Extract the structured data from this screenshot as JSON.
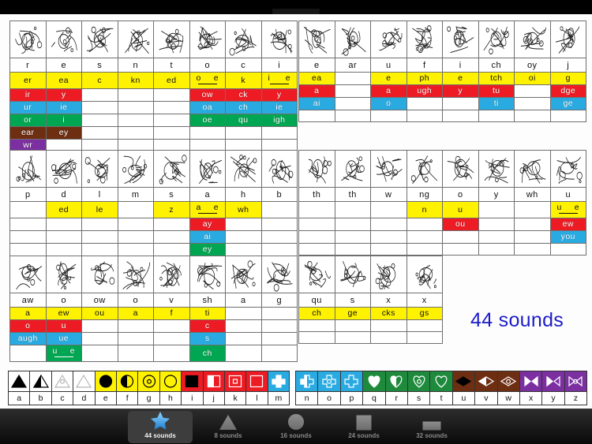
{
  "app": {
    "title": "44 sounds",
    "caption": "44 sounds",
    "caption_color": "#1B1BC9"
  },
  "colors": {
    "yellow": "#FFF200",
    "red": "#ED1C24",
    "blue": "#29ABE2",
    "green": "#00A651",
    "brown": "#6D2E12",
    "purple": "#7B2FA0",
    "accent": "#1B1BC9"
  },
  "tables": [
    {
      "id": "table-1",
      "headers": [
        "r",
        "e",
        "s",
        "n",
        "t",
        "o",
        "c",
        "i"
      ],
      "rows": [
        {
          "color": "yellow",
          "cells": [
            "er",
            "ea",
            "c",
            "kn",
            "ed",
            "o_e",
            "k",
            "i_e"
          ]
        },
        {
          "color": "red",
          "cells": [
            "ir",
            "y",
            "",
            "",
            "",
            "ow",
            "ck",
            "y"
          ]
        },
        {
          "color": "blue",
          "cells": [
            "ur",
            "ie",
            "",
            "",
            "",
            "oa",
            "ch",
            "ie"
          ]
        },
        {
          "color": "green",
          "cells": [
            "or",
            "i",
            "",
            "",
            "",
            "oe",
            "qu",
            "igh"
          ]
        },
        {
          "color": "brown",
          "cells": [
            "ear",
            "ey",
            "",
            "",
            "",
            "",
            "",
            ""
          ]
        },
        {
          "color": "purple",
          "cells": [
            "wr",
            "",
            "",
            "",
            "",
            "",
            "",
            ""
          ]
        }
      ]
    },
    {
      "id": "table-2",
      "headers": [
        "e",
        "ar",
        "u",
        "f",
        "i",
        "ch",
        "oy",
        "j"
      ],
      "rows": [
        {
          "color": "yellow",
          "cells": [
            "ea",
            "",
            "e",
            "ph",
            "e",
            "tch",
            "oi",
            "g"
          ]
        },
        {
          "color": "red",
          "cells": [
            "a",
            "",
            "a",
            "ugh",
            "y",
            "tu",
            "",
            "dge"
          ]
        },
        {
          "color": "blue",
          "cells": [
            "ai",
            "",
            "o",
            "",
            "",
            "ti",
            "",
            "ge"
          ]
        },
        {
          "color": "blank",
          "cells": [
            "",
            "",
            "",
            "",
            "",
            "",
            "",
            ""
          ]
        }
      ]
    },
    {
      "id": "table-3",
      "headers": [
        "p",
        "d",
        "l",
        "m",
        "s",
        "a",
        "h",
        "b"
      ],
      "rows": [
        {
          "color": "yellow",
          "cells": [
            "",
            "ed",
            "le",
            "",
            "z",
            "a_e",
            "wh",
            ""
          ]
        },
        {
          "color": "red",
          "cells": [
            "",
            "",
            "",
            "",
            "",
            "ay",
            "",
            ""
          ]
        },
        {
          "color": "blue",
          "cells": [
            "",
            "",
            "",
            "",
            "",
            "ai",
            "",
            ""
          ]
        },
        {
          "color": "green",
          "cells": [
            "",
            "",
            "",
            "",
            "",
            "ey",
            "",
            ""
          ]
        }
      ]
    },
    {
      "id": "table-4",
      "headers": [
        "th",
        "th",
        "w",
        "ng",
        "o",
        "y",
        "wh",
        "u"
      ],
      "rows": [
        {
          "color": "yellow",
          "cells": [
            "",
            "",
            "",
            "n",
            "u",
            "",
            "",
            "u_e"
          ]
        },
        {
          "color": "red",
          "cells": [
            "",
            "",
            "",
            "",
            "ou",
            "",
            "",
            "ew"
          ]
        },
        {
          "color": "blue",
          "cells": [
            "",
            "",
            "",
            "",
            "",
            "",
            "",
            "you"
          ]
        },
        {
          "color": "blank",
          "cells": [
            "",
            "",
            "",
            "",
            "",
            "",
            "",
            ""
          ]
        }
      ]
    },
    {
      "id": "table-5",
      "headers": [
        "aw",
        "o",
        "ow",
        "o",
        "v",
        "sh",
        "a",
        "g"
      ],
      "rows": [
        {
          "color": "yellow",
          "cells": [
            "a",
            "ew",
            "ou",
            "a",
            "f",
            "ti",
            "",
            ""
          ]
        },
        {
          "color": "red",
          "cells": [
            "o",
            "u",
            "",
            "",
            "",
            "c",
            "",
            ""
          ]
        },
        {
          "color": "blue",
          "cells": [
            "augh",
            "ue",
            "",
            "",
            "",
            "s",
            "",
            ""
          ]
        },
        {
          "color": "green",
          "cells": [
            "",
            "u_e",
            "",
            "",
            "",
            "ch",
            "",
            ""
          ]
        }
      ]
    },
    {
      "id": "table-6",
      "headers": [
        "qu",
        "s",
        "x",
        "x"
      ],
      "rows": [
        {
          "color": "yellow",
          "cells": [
            "ch",
            "ge",
            "cks",
            "gs"
          ]
        },
        {
          "color": "blank",
          "cells": [
            "",
            "",
            "",
            ""
          ]
        },
        {
          "color": "blank",
          "cells": [
            "",
            "",
            "",
            ""
          ]
        }
      ]
    }
  ],
  "legend": {
    "left": {
      "letters": [
        "a",
        "b",
        "c",
        "d",
        "e",
        "f",
        "g",
        "h",
        "i",
        "j",
        "k",
        "l",
        "m"
      ],
      "symbols": [
        {
          "icon": "triangle-filled-icon",
          "shape": "triangle",
          "fill": "full",
          "bg": "#ffffff",
          "ink": "#000000"
        },
        {
          "icon": "triangle-half-icon",
          "shape": "triangle",
          "fill": "half",
          "bg": "#ffffff",
          "ink": "#000000"
        },
        {
          "icon": "triangle-dot-icon",
          "shape": "triangle",
          "fill": "dot",
          "bg": "#ffffff",
          "ink": "#b5b5b5"
        },
        {
          "icon": "triangle-outline-icon",
          "shape": "triangle",
          "fill": "outline",
          "bg": "#ffffff",
          "ink": "#b5b5b5"
        },
        {
          "icon": "circle-filled-icon",
          "shape": "circle",
          "fill": "full",
          "bg": "#FFF200",
          "ink": "#000000"
        },
        {
          "icon": "circle-half-icon",
          "shape": "circle",
          "fill": "half",
          "bg": "#FFF200",
          "ink": "#000000"
        },
        {
          "icon": "circle-dot-icon",
          "shape": "circle",
          "fill": "dot",
          "bg": "#FFF200",
          "ink": "#000000"
        },
        {
          "icon": "circle-outline-icon",
          "shape": "circle",
          "fill": "outline",
          "bg": "#FFF200",
          "ink": "#000000"
        },
        {
          "icon": "square-filled-icon",
          "shape": "square",
          "fill": "full",
          "bg": "#ED1C24",
          "ink": "#000000"
        },
        {
          "icon": "square-half-icon",
          "shape": "square",
          "fill": "half",
          "bg": "#ED1C24",
          "ink": "#ffffff"
        },
        {
          "icon": "square-dot-icon",
          "shape": "square",
          "fill": "dot",
          "bg": "#ED1C24",
          "ink": "#ffffff"
        },
        {
          "icon": "square-outline-icon",
          "shape": "square",
          "fill": "outline",
          "bg": "#ED1C24",
          "ink": "#ffffff"
        },
        {
          "icon": "cross-filled-icon",
          "shape": "cross",
          "fill": "full",
          "bg": "#29ABE2",
          "ink": "#ffffff"
        }
      ]
    },
    "right": {
      "letters": [
        "n",
        "o",
        "p",
        "q",
        "r",
        "s",
        "t",
        "u",
        "v",
        "w",
        "x",
        "y",
        "z"
      ],
      "symbols": [
        {
          "icon": "cross-half-icon",
          "shape": "cross",
          "fill": "half",
          "bg": "#29ABE2",
          "ink": "#ffffff"
        },
        {
          "icon": "cross-dot-icon",
          "shape": "cross",
          "fill": "dot",
          "bg": "#29ABE2",
          "ink": "#ffffff"
        },
        {
          "icon": "cross-outline-icon",
          "shape": "cross",
          "fill": "outline",
          "bg": "#29ABE2",
          "ink": "#ffffff"
        },
        {
          "icon": "heart-filled-icon",
          "shape": "heart",
          "fill": "full",
          "bg": "#1E8A3C",
          "ink": "#ffffff"
        },
        {
          "icon": "heart-half-icon",
          "shape": "heart",
          "fill": "half",
          "bg": "#1E8A3C",
          "ink": "#ffffff"
        },
        {
          "icon": "heart-dot-icon",
          "shape": "heart",
          "fill": "dot",
          "bg": "#1E8A3C",
          "ink": "#ffffff"
        },
        {
          "icon": "heart-outline-icon",
          "shape": "heart",
          "fill": "outline",
          "bg": "#1E8A3C",
          "ink": "#ffffff"
        },
        {
          "icon": "diamond-filled-icon",
          "shape": "diamond",
          "fill": "full",
          "bg": "#6D2E12",
          "ink": "#000000"
        },
        {
          "icon": "diamond-half-icon",
          "shape": "diamond",
          "fill": "half",
          "bg": "#6D2E12",
          "ink": "#ffffff"
        },
        {
          "icon": "diamond-dot-icon",
          "shape": "diamond",
          "fill": "dot",
          "bg": "#6D2E12",
          "ink": "#ffffff"
        },
        {
          "icon": "bowtie-filled-icon",
          "shape": "bowtie",
          "fill": "full",
          "bg": "#7B2FA0",
          "ink": "#ffffff"
        },
        {
          "icon": "bowtie-half-icon",
          "shape": "bowtie",
          "fill": "half",
          "bg": "#7B2FA0",
          "ink": "#ffffff"
        },
        {
          "icon": "bowtie-dot-icon",
          "shape": "bowtie",
          "fill": "dot",
          "bg": "#7B2FA0",
          "ink": "#ffffff"
        }
      ]
    }
  },
  "tabbar": {
    "tabs": [
      {
        "label": "44 sounds",
        "icon": "star-icon",
        "selected": true
      },
      {
        "label": "8 sounds",
        "icon": "triangle-icon",
        "selected": false
      },
      {
        "label": "16 sounds",
        "icon": "circle-icon",
        "selected": false
      },
      {
        "label": "24 sounds",
        "icon": "square-icon",
        "selected": false
      },
      {
        "label": "32 sounds",
        "icon": "rectangle-icon",
        "selected": false
      }
    ]
  }
}
